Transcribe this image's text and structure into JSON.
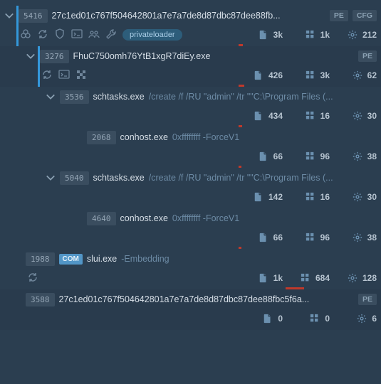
{
  "nodes": [
    {
      "pid": "5416",
      "name": "27c1ed01c767f504642801a7e7a7de8d87dbc87dee88fb...",
      "tags": [
        "PE",
        "CFG"
      ],
      "labels": [
        "privateloader"
      ],
      "icons": [
        "biohazard",
        "sync",
        "shield",
        "terminal",
        "people",
        "wrench"
      ],
      "stats": {
        "doc": "3k",
        "grid": "1k",
        "gear": "212"
      },
      "red": 6,
      "accent": true,
      "indent": 20,
      "caret": true,
      "children": [
        {
          "pid": "3276",
          "name": "FhuC750omh76YtB1xgR7diEy.exe",
          "tags": [
            "PE"
          ],
          "icons": [
            "sync",
            "terminal",
            "grid4"
          ],
          "stats": {
            "doc": "426",
            "grid": "3k",
            "gear": "62"
          },
          "red": 8,
          "accent": true,
          "indent": 50,
          "caret": true,
          "highlight": true,
          "children": [
            {
              "pid": "3536",
              "name": "schtasks.exe",
              "args": "/create /f /RU \"admin\" /tr \"\"C:\\Program Files (...",
              "stats": {
                "doc": "434",
                "grid": "16",
                "gear": "30"
              },
              "red": 5,
              "indent": 78,
              "caret": true,
              "children": [
                {
                  "pid": "2068",
                  "name": "conhost.exe",
                  "args": "0xffffffff -ForceV1",
                  "stats": {
                    "doc": "66",
                    "grid": "96",
                    "gear": "38"
                  },
                  "red": 4,
                  "indent": 116
                }
              ]
            },
            {
              "pid": "5040",
              "name": "schtasks.exe",
              "args": "/create /f /RU \"admin\" /tr \"\"C:\\Program Files (...",
              "stats": {
                "doc": "142",
                "grid": "16",
                "gear": "30"
              },
              "indent": 78,
              "caret": true,
              "children": [
                {
                  "pid": "4640",
                  "name": "conhost.exe",
                  "args": "0xffffffff -ForceV1",
                  "stats": {
                    "doc": "66",
                    "grid": "96",
                    "gear": "38"
                  },
                  "red": 4,
                  "indent": 116
                }
              ]
            }
          ]
        }
      ]
    },
    {
      "pid": "1988",
      "com": true,
      "name": "slui.exe",
      "args": "-Embedding",
      "icons": [
        "sync"
      ],
      "stats": {
        "doc": "1k",
        "grid": "684",
        "gear": "128"
      },
      "red": 26,
      "redOffset": 1,
      "indent": 30
    },
    {
      "pid": "3588",
      "name": "27c1ed01c767f504642801a7e7a7de8d87dbc87dee88fbc5f6a...",
      "tags": [
        "PE"
      ],
      "stats": {
        "doc": "0",
        "grid": "0",
        "gear": "6"
      },
      "indent": 30,
      "highlight": true
    }
  ]
}
